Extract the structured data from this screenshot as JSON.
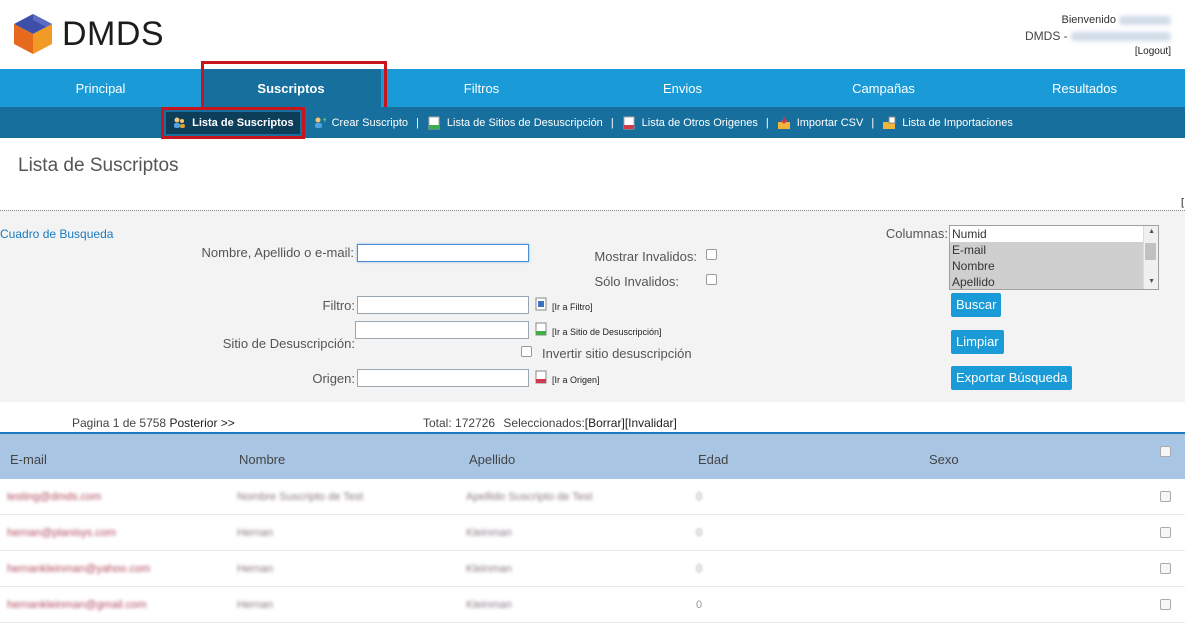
{
  "header": {
    "logo_text": "DMDS",
    "welcome_label": "Bienvenido",
    "app_line_prefix": "DMDS -",
    "logout_label": "[Logout]"
  },
  "mainnav": {
    "items": [
      {
        "label": "Principal"
      },
      {
        "label": "Suscriptos",
        "active": true
      },
      {
        "label": "Filtros"
      },
      {
        "label": "Envios"
      },
      {
        "label": "Campañas"
      },
      {
        "label": "Resultados"
      }
    ]
  },
  "subnav": {
    "items": [
      {
        "label": "Lista de Suscriptos",
        "icon": "users-icon",
        "active": true
      },
      {
        "label": "Crear Suscripto",
        "icon": "add-user-icon"
      },
      {
        "label": "Lista de Sitios de Desuscripción",
        "icon": "green-doc-icon"
      },
      {
        "label": "Lista de Otros Origenes",
        "icon": "red-doc-icon"
      },
      {
        "label": "Importar CSV",
        "icon": "import-icon"
      },
      {
        "label": "Lista de Importaciones",
        "icon": "import-list-icon"
      }
    ],
    "separator": "|"
  },
  "page": {
    "title": "Lista de Suscriptos",
    "corner_mark": "["
  },
  "search": {
    "title": "Cuadro de Busqueda",
    "name_label": "Nombre, Apellido o e-mail:",
    "name_value": "",
    "show_invalid_label": "Mostrar Invalidos:",
    "only_invalid_label": "Sólo Invalidos:",
    "filter_label": "Filtro:",
    "filter_link": "[Ir a Filtro]",
    "unsub_label": "Sitio de Desuscripción:",
    "unsub_link": "[Ir a Sitio de Desuscripción]",
    "invert_label": "Invertir sitio desuscripción",
    "origin_label": "Origen:",
    "origin_link": "[Ir a Origen]",
    "columns_label": "Columnas:",
    "columns_options": [
      "Numid",
      "E-mail",
      "Nombre",
      "Apellido"
    ],
    "buttons": {
      "search": "Buscar",
      "clear": "Limpiar",
      "export": "Exportar Búsqueda"
    }
  },
  "pagination": {
    "page_text": "Pagina 1 de 5758",
    "next_label": "Posterior >>",
    "total_text": "Total: 172726",
    "selected_label": "Seleccionados:",
    "delete_link": "[Borrar]",
    "invalidate_link": "[Invalidar]"
  },
  "table": {
    "headers": [
      "E-mail",
      "Nombre",
      "Apellido",
      "Edad",
      "Sexo"
    ],
    "rows": [
      {
        "email": "testing@dmds.com",
        "name": "Nombre Suscripto de Test",
        "surname": "Apellido Suscripto de Test",
        "age": "0"
      },
      {
        "email": "hernan@planisys.com",
        "name": "Hernan",
        "surname": "Kleinman",
        "age": "0"
      },
      {
        "email": "hernankleinman@yahoo.com",
        "name": "Hernan",
        "surname": "Kleinman",
        "age": "0"
      },
      {
        "email": "hernankleinman@gmail.com",
        "name": "Hernan",
        "surname": "Kleinman",
        "age": "0"
      }
    ]
  },
  "colors": {
    "primary_blue": "#1a9bd7",
    "dark_blue": "#166f9c",
    "highlight_red": "#c8141c",
    "table_header": "#a8c6e3"
  }
}
